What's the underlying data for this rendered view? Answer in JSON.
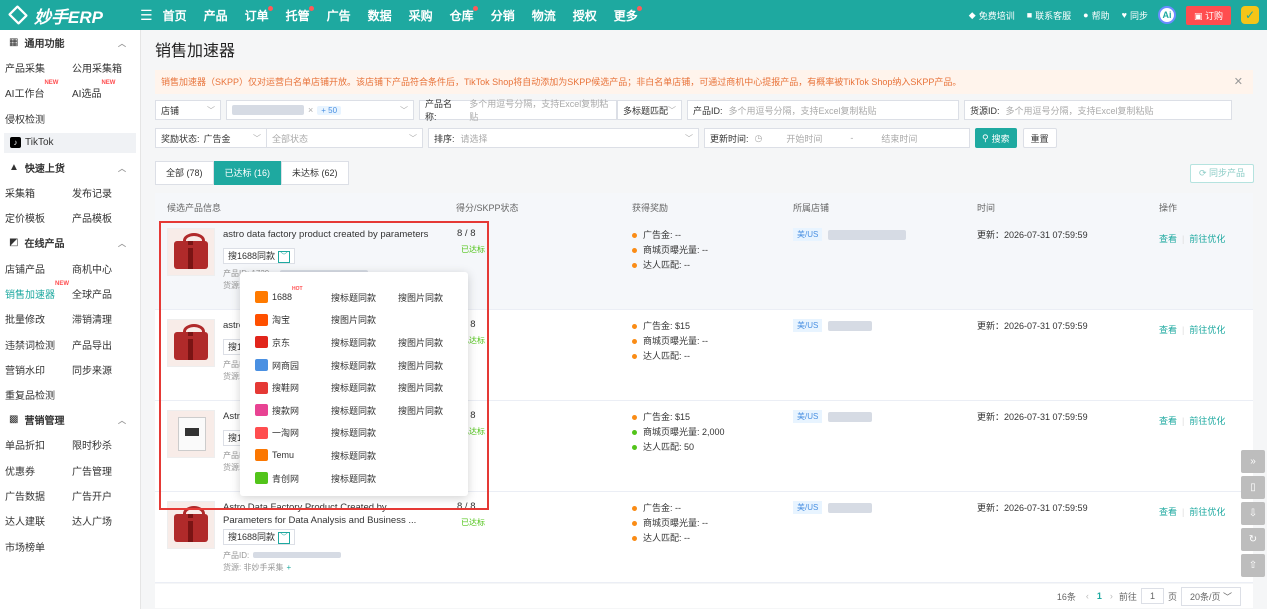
{
  "brand": {
    "name": "妙手ERP"
  },
  "nav": [
    {
      "label": "首页",
      "dot": false
    },
    {
      "label": "产品",
      "dot": false
    },
    {
      "label": "订单",
      "dot": true
    },
    {
      "label": "托管",
      "dot": true
    },
    {
      "label": "广告",
      "dot": false
    },
    {
      "label": "数据",
      "dot": false
    },
    {
      "label": "采购",
      "dot": false
    },
    {
      "label": "仓库",
      "dot": true
    },
    {
      "label": "分销",
      "dot": false
    },
    {
      "label": "物流",
      "dot": false
    },
    {
      "label": "授权",
      "dot": false
    },
    {
      "label": "更多",
      "dot": true
    }
  ],
  "topright": {
    "training": "免费培训",
    "support": "联系客服",
    "help": "帮助",
    "sync": "同步",
    "ai": "Ai",
    "order": "订购"
  },
  "sidebar": {
    "g1": "通用功能",
    "r1": [
      "产品采集",
      "公用采集箱"
    ],
    "r2": [
      "AI工作台",
      "AI选品"
    ],
    "r2badge": "NEW",
    "r3": [
      "侵权检测"
    ],
    "tiktok": "TikTok",
    "g2": "快速上货",
    "r4": [
      "采集箱",
      "发布记录"
    ],
    "r5": [
      "定价模板",
      "产品模板"
    ],
    "g3": "在线产品",
    "r6": [
      "店铺产品",
      "商机中心"
    ],
    "r7": [
      "销售加速器",
      "全球产品"
    ],
    "r8": [
      "批量修改",
      "滞销清理"
    ],
    "r9": [
      "违禁词检测",
      "产品导出"
    ],
    "r10": [
      "营销水印",
      "同步来源"
    ],
    "r11": [
      "重复品检测"
    ],
    "g4": "营销管理",
    "r12": [
      "单品折扣",
      "限时秒杀"
    ],
    "r13": [
      "优惠券",
      "广告管理"
    ],
    "r14": [
      "广告数据",
      "广告开户"
    ],
    "r15": [
      "达人建联",
      "达人广场"
    ],
    "r16": [
      "市场榜单"
    ]
  },
  "page": {
    "title": "销售加速器"
  },
  "notice": "销售加速器（SKPP）仅对运营白名单店铺开放。该店铺下产品符合条件后，TikTok Shop将自动添加为SKPP候选产品；非白名单店铺，可通过商机中心提报产品，有概率被TikTok Shop纳入SKPP产品。",
  "filters": {
    "store_label": "店铺",
    "store_more": "+ 50",
    "name_label": "产品名称:",
    "name_ph": "多个用逗号分隔，支持Excel复制粘贴",
    "name_match": "多标题匹配",
    "pid_label": "产品ID:",
    "pid_ph": "多个用逗号分隔，支持Excel复制粘贴",
    "src_label": "货源ID:",
    "src_ph": "多个用逗号分隔，支持Excel复制粘贴",
    "reward_label": "奖励状态:",
    "reward_val": "广告金",
    "status_ph": "全部状态",
    "sort_label": "排序:",
    "sort_ph": "请选择",
    "time_label": "更新时间:",
    "start_ph": "开始时间",
    "end_ph": "结束时间",
    "sep": "-",
    "search": "搜索",
    "reset": "重置"
  },
  "tabs": [
    {
      "label": "全部 (78)",
      "active": false
    },
    {
      "label": "已达标 (16)",
      "active": true
    },
    {
      "label": "未达标 (62)",
      "active": false
    }
  ],
  "sync_btn": "同步产品",
  "table": {
    "headers": [
      "候选产品信息",
      "得分/SKPP状态",
      "获得奖励",
      "所属店铺",
      "时间",
      "操作"
    ],
    "rows": [
      {
        "name": "astro data factory product created by parameters",
        "tag": "搜1688同款",
        "meta1": "产品ID: 1729...",
        "meta2": "货源:",
        "score": "8 / 8",
        "status": "已达标",
        "r1": "广告金: --",
        "r2": "商城页曝光量: --",
        "r3": "达人匹配: --",
        "r3c": "o",
        "store": "美/US",
        "time": "更新：2026-07-31 07:59:59",
        "img": "gift",
        "hl": true
      },
      {
        "name": "astro... Aud...",
        "tag": "搜1688同款",
        "meta1": "产品ID:",
        "meta2": "货源:",
        "score": "8 / 8",
        "status": "已达标",
        "r1": "广告金: $15",
        "r2": "商城页曝光量: --",
        "r3": "达人匹配: --",
        "r3c": "o",
        "store": "美/US",
        "time": "更新：2026-07-31 07:59:59",
        "img": "gift",
        "hl": false
      },
      {
        "name": "Astr... Para...",
        "tag": "搜1688同款",
        "meta1": "产品ID:",
        "meta2": "货源:",
        "score": "8 / 8",
        "status": "已达标",
        "r1": "广告金: $15",
        "r2": "商城页曝光量: 2,000",
        "r3": "达人匹配: 50",
        "r3c": "g",
        "store": "美/US",
        "time": "更新：2026-07-31 07:59:59",
        "img": "shirt",
        "hl": false
      },
      {
        "name": "Astro Data Factory Product Created by Parameters for Data Analysis and Business ...",
        "tag": "搜1688同款",
        "meta1": "产品ID:",
        "meta2": "货源: 非妙手采集",
        "score": "8 / 8",
        "status": "已达标",
        "r1": "广告金: --",
        "r2": "商城页曝光量: --",
        "r3": "达人匹配: --",
        "r3c": "o",
        "store": "美/US",
        "time": "更新：2026-07-31 07:59:59",
        "img": "gift",
        "hl": false
      }
    ],
    "op_view": "查看",
    "op_opt": "前往优化"
  },
  "popup": [
    {
      "name": "1688",
      "color": "#ff7a00",
      "hot": "HOT",
      "c1": "搜标题同款",
      "c2": "搜图片同款"
    },
    {
      "name": "淘宝",
      "color": "#ff5000",
      "c1": "搜图片同款",
      "c2": ""
    },
    {
      "name": "京东",
      "color": "#e1251b",
      "c1": "搜标题同款",
      "c2": "搜图片同款"
    },
    {
      "name": "网商园",
      "color": "#4a90e2",
      "c1": "搜标题同款",
      "c2": "搜图片同款"
    },
    {
      "name": "搜鞋网",
      "color": "#e53935",
      "c1": "搜标题同款",
      "c2": "搜图片同款"
    },
    {
      "name": "搜款网",
      "color": "#e84393",
      "c1": "搜标题同款",
      "c2": "搜图片同款"
    },
    {
      "name": "一淘网",
      "color": "#ff4d4f",
      "c1": "搜标题同款",
      "c2": ""
    },
    {
      "name": "Temu",
      "color": "#fb7701",
      "c1": "搜标题同款",
      "c2": ""
    },
    {
      "name": "青创网",
      "color": "#52c41a",
      "c1": "搜标题同款",
      "c2": ""
    }
  ],
  "pager": {
    "total": "16条",
    "page": "1",
    "goto": "前往",
    "page_box": "1",
    "page_unit": "页",
    "size": "20条/页"
  }
}
